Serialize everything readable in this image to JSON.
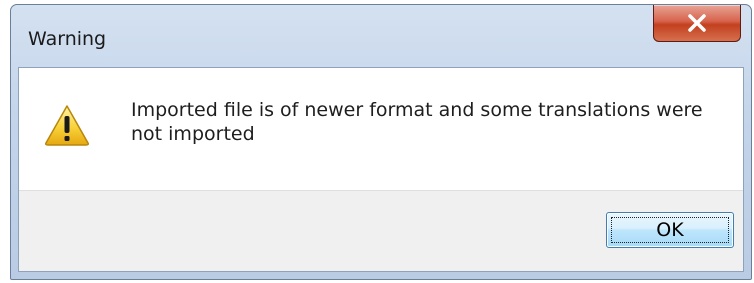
{
  "window": {
    "title": "Warning"
  },
  "dialog": {
    "icon": "warning-icon",
    "message": "Imported file is of newer format and some translations were not imported",
    "ok_label": "OK"
  },
  "colors": {
    "close_button": "#c2401f",
    "ok_button": "#bee6fd",
    "warning_yellow": "#f8d23a"
  }
}
